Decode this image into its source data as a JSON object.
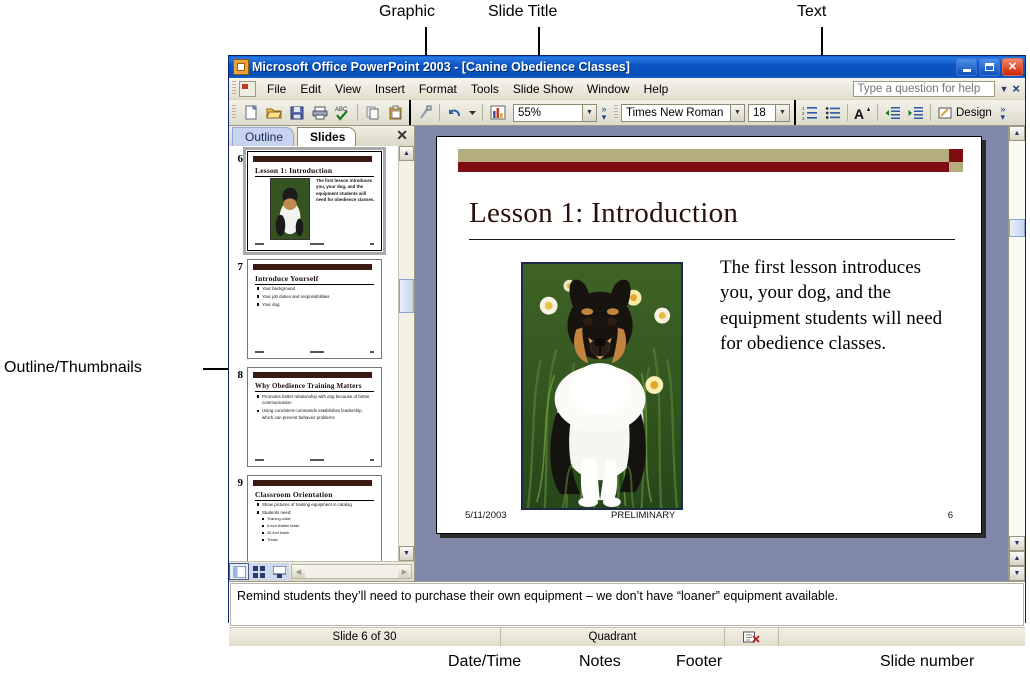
{
  "annotations": [
    {
      "id": "graphic",
      "label": "Graphic"
    },
    {
      "id": "slide_title",
      "label": "Slide Title"
    },
    {
      "id": "text",
      "label": "Text"
    },
    {
      "id": "outline_thumbnails",
      "label": "Outline/Thumbnails"
    },
    {
      "id": "date_time",
      "label": "Date/Time"
    },
    {
      "id": "notes",
      "label": "Notes"
    },
    {
      "id": "footer",
      "label": "Footer"
    },
    {
      "id": "slide_number",
      "label": "Slide number"
    }
  ],
  "window": {
    "title": "Microsoft Office PowerPoint 2003  - [Canine Obedience Classes]",
    "icon": "powerpoint-icon",
    "buttons": {
      "minimize": "minimize-icon",
      "restore": "restore-icon",
      "close": "close-icon"
    }
  },
  "menubar": {
    "items": [
      "File",
      "Edit",
      "View",
      "Insert",
      "Format",
      "Tools",
      "Slide Show",
      "Window",
      "Help"
    ],
    "ask_placeholder": "Type a question for help",
    "ask_value": "",
    "close_label": "×"
  },
  "toolbar": {
    "icons": [
      "new-icon",
      "open-icon",
      "save-icon",
      "print-icon",
      "spelling-icon",
      "copy-icon",
      "paste-icon",
      "format-painter-icon",
      "undo-icon",
      "chart-icon"
    ],
    "zoom": "55%",
    "font_name": "Times New Roman",
    "font_size": "18",
    "right_icons": [
      "numbering-icon",
      "bullets-icon",
      "increase-font-icon",
      "decrease-indent-icon",
      "increase-indent-icon"
    ],
    "design_label": "Design"
  },
  "left_pane": {
    "tabs": [
      {
        "label": "Outline",
        "active": false
      },
      {
        "label": "Slides",
        "active": true
      }
    ],
    "close_label": "✕",
    "thumbnails": [
      {
        "number": "6",
        "title": "Lesson 1: Introduction",
        "selected": true,
        "kind": "image-text",
        "text": "The first lesson introduces you, your dog, and the equipment students will need for obedience classes."
      },
      {
        "number": "7",
        "title": "Introduce Yourself",
        "selected": false,
        "kind": "bullets",
        "bullets": [
          {
            "text": "Your background",
            "sub": []
          },
          {
            "text": "Your job duties and responsibilities",
            "sub": []
          },
          {
            "text": "Your dog",
            "sub": []
          }
        ]
      },
      {
        "number": "8",
        "title": "Why Obedience Training Matters",
        "selected": false,
        "kind": "bullets",
        "bullets": [
          {
            "text": "Promotes better relationship with dog because of better communication",
            "sub": []
          },
          {
            "text": "Using consistent commands establishes leadership, which can prevent behavior problems",
            "sub": []
          }
        ]
      },
      {
        "number": "9",
        "title": "Classroom Orientation",
        "selected": false,
        "kind": "bullets",
        "bullets": [
          {
            "text": "Show pictures of training equipment in catalog",
            "sub": []
          },
          {
            "text": "Students need:",
            "sub": [
              "Training collar",
              "6-foot leather leash",
              "30-foot leash",
              "Treats"
            ]
          }
        ]
      }
    ],
    "view_buttons": [
      "normal-view-icon",
      "slide-sorter-view-icon",
      "slide-show-icon"
    ]
  },
  "slide": {
    "title": "Lesson 1: Introduction",
    "body_text": "The first lesson introduces you, your dog, and the equipment students will need for obedience classes.",
    "image_alt": "shetland-sheepdog-photo",
    "date": "5/11/2003",
    "footer": "PRELIMINARY",
    "number": "6",
    "colors": {
      "banner_top": "#b6ad7f",
      "banner_bottom": "#7e0c13",
      "title_text": "#2a1008"
    }
  },
  "notes": {
    "text": "Remind students they’ll need to purchase their own equipment – we don’t have “loaner” equipment available."
  },
  "statusbar": {
    "slide_counter": "Slide 6 of 30",
    "design_name": "Quadrant",
    "language_icon": "spell-check-icon"
  }
}
